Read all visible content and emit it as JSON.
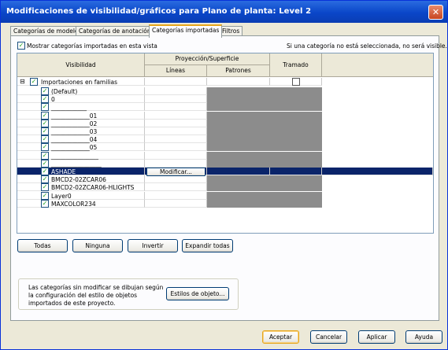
{
  "window": {
    "title": "Modificaciones de visibilidad/gráficos para Plano de planta: Level 2",
    "close_glyph": "✕"
  },
  "tabs": [
    "Categorías de modelo",
    "Categorías de anotación",
    "Categorías importadas",
    "Filtros"
  ],
  "options": {
    "show_imported_label": "Mostrar categorías importadas en esta vista",
    "show_imported_checked": true,
    "hint": "Si una categoría no está seleccionada, no será visible."
  },
  "columns": {
    "visibility": "Visibilidad",
    "projection_surface": "Proyección/Superficie",
    "lines": "Líneas",
    "patterns": "Patrones",
    "halftone": "Tramado"
  },
  "tree_root": {
    "expander": "⊟",
    "label": "Importaciones en familias"
  },
  "rows": [
    {
      "label": "(Default)",
      "checked": true
    },
    {
      "label": "0",
      "checked": true
    },
    {
      "label": "____________",
      "checked": true
    },
    {
      "label": "_____________01",
      "checked": true
    },
    {
      "label": "_____________02",
      "checked": true
    },
    {
      "label": "_____________03",
      "checked": true
    },
    {
      "label": "_____________04",
      "checked": true
    },
    {
      "label": "_____________05",
      "checked": true
    },
    {
      "label": "________________",
      "checked": true
    },
    {
      "label": "_________________",
      "checked": true
    },
    {
      "label": "ASHADE",
      "checked": true,
      "selected": true,
      "lines_button": "Modificar..."
    },
    {
      "label": "BMCD2-02ZCAR06",
      "checked": true
    },
    {
      "label": "BMCD2-02ZCAR06-HLIGHTS",
      "checked": true
    },
    {
      "label": "Layer0",
      "checked": true
    },
    {
      "label": "MAXCOLOR234",
      "checked": true
    }
  ],
  "check_glyph": "✓",
  "action_buttons": [
    "Todas",
    "Ninguna",
    "Invertir",
    "Expandir todas"
  ],
  "info": {
    "text": "Las categorías sin modificar se dibujan según la configuración del estilo de objetos importados de este proyecto.",
    "button": "Estilos de objeto..."
  },
  "footer": [
    "Aceptar",
    "Cancelar",
    "Aplicar",
    "Ayuda"
  ],
  "colors": {
    "titlebar": "#0a46c8",
    "selection": "#0a246a",
    "gray_cell": "#8c8c8c",
    "window_bg": "#ece9d8"
  }
}
